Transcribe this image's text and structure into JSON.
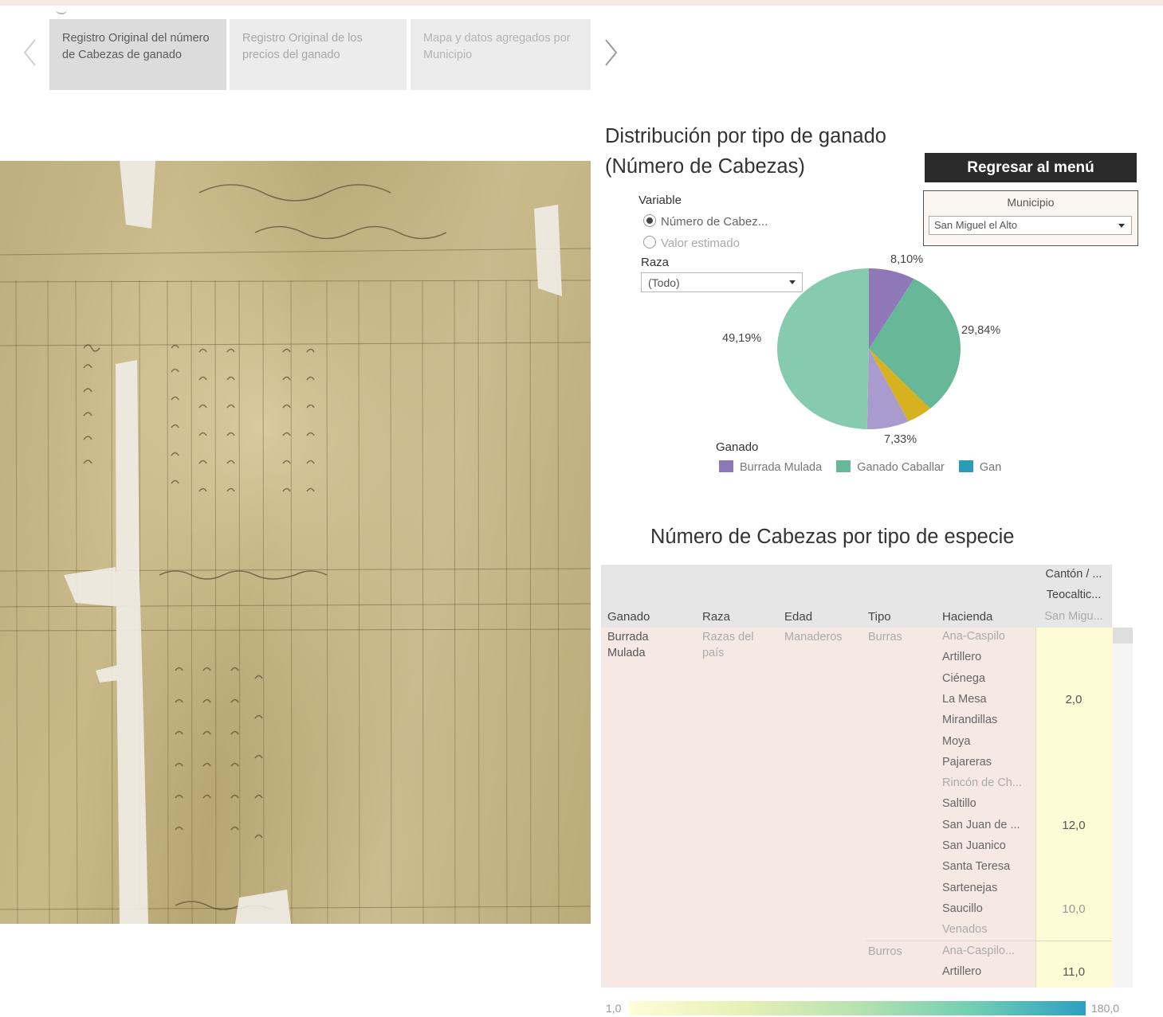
{
  "story_tabs": [
    {
      "label": "Registro Original del número de Cabezas de ganado"
    },
    {
      "label": "Registro Original de los precios del ganado"
    },
    {
      "label": "Mapa y datos agregados por Municipio"
    }
  ],
  "chart": {
    "title_line1": "Distribución por tipo de ganado",
    "title_line2": "(Número de Cabezas)"
  },
  "back_button": "Regresar al menú",
  "municipio": {
    "label": "Municipio",
    "selected": "San Miguel el Alto"
  },
  "variable": {
    "label": "Variable",
    "options": [
      "Número de Cabez...",
      "Valor estimado"
    ],
    "selected": 0
  },
  "raza": {
    "label": "Raza",
    "selected": "(Todo)"
  },
  "legend": {
    "title": "Ganado",
    "items": [
      "Burrada Mulada",
      "Ganado Caballar",
      "Gan"
    ]
  },
  "colors": {
    "burrada_mulada": "#8e78b8",
    "ganado_caballar": "#67b898",
    "ganado_3": "#2a9cb5",
    "slice_gold": "#d6b120",
    "slice_lavender": "#a99bcd",
    "slice_main": "#86cbb0"
  },
  "chart_data": {
    "type": "pie",
    "title": "Distribución por tipo de ganado (Número de Cabezas)",
    "slices": [
      {
        "name": "Burrada Mulada",
        "value": 8.1,
        "label": "8,10%"
      },
      {
        "name": "Ganado Caballar",
        "value": 29.84,
        "label": "29,84%"
      },
      {
        "name": "",
        "value": 4.54,
        "label": ""
      },
      {
        "name": "",
        "value": 7.33,
        "label": "7,33%"
      },
      {
        "name": "",
        "value": 49.19,
        "label": "49,19%"
      }
    ]
  },
  "table": {
    "title": "Número de Cabezas por tipo de especie",
    "headers": [
      "Ganado",
      "Raza",
      "Edad",
      "Tipo",
      "Hacienda"
    ],
    "col_header": {
      "line1": "Cantón / ...",
      "line2": "Teocaltic...",
      "line3": "San Migu..."
    },
    "ganado": "Burrada Mulada",
    "raza": "Razas del país",
    "edad": "Manaderos",
    "tipo1": "Burras",
    "tipo2": "Burros",
    "haciendas_group1": [
      "Ana-Caspilo",
      "Artillero",
      "Ciénega",
      "La Mesa",
      "Mirandillas",
      "Moya",
      "Pajareras",
      "Rincón de Ch...",
      "Saltillo",
      "San Juan de ...",
      "San Juanico",
      "Santa Teresa",
      "Sartenejas",
      "Saucillo",
      "Venados"
    ],
    "haciendas_group2": [
      "Ana-Caspilo...",
      "Artillero"
    ],
    "values": [
      {
        "row": 3,
        "value": "2,0"
      },
      {
        "row": 9,
        "value": "12,0"
      },
      {
        "row": 13,
        "value": "10,0"
      },
      {
        "row": 16,
        "value": "11,0"
      }
    ]
  },
  "color_scale": {
    "min": "1,0",
    "max": "180,0"
  }
}
